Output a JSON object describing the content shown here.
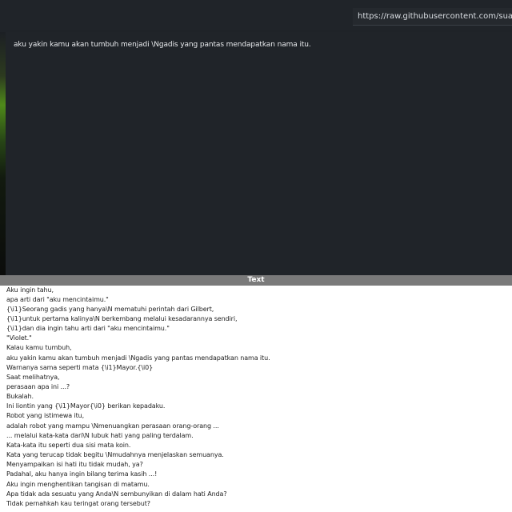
{
  "browser": {
    "url": "https://raw.githubusercontent.com/suakaani..."
  },
  "preview": {
    "caption": "aku yakin kamu akan tumbuh menjadi \\Ngadis yang pantas mendapatkan nama itu."
  },
  "text_panel": {
    "header": "Text",
    "lines": [
      "Aku ingin tahu,",
      "apa arti dari \"aku mencintaimu.\"",
      "{\\i1}Seorang gadis yang hanya\\N mematuhi perintah dari Gilbert,",
      "{\\i1}untuk pertama kalinya\\N berkembang melalui kesadarannya sendiri,",
      "{\\i1}dan dia ingin tahu arti dari \"aku mencintaimu.\"",
      "\"Violet.\"",
      "Kalau kamu tumbuh,",
      "aku yakin kamu akan tumbuh menjadi \\Ngadis yang pantas mendapatkan nama itu.",
      "Warnanya sama seperti mata {\\i1}Mayor.{\\i0}",
      "Saat melihatnya,",
      "perasaan apa ini ...?",
      "Bukalah.",
      "Ini liontin yang {\\i1}Mayor{\\i0} berikan kepadaku.",
      "Robot yang istimewa itu,",
      "adalah robot yang mampu \\Nmenuangkan perasaan orang-orang ...",
      "... melalui kata-kata dari\\N lubuk hati yang paling terdalam.",
      "Kata-kata itu seperti dua sisi mata koin.",
      "Kata yang terucap tidak begitu \\Nmudahnya menjelaskan semuanya.",
      "Menyampaikan isi hati itu tidak mudah, ya?",
      "Padahal, aku hanya ingin bilang terima kasih ...!",
      "Aku ingin menghentikan tangisan di matamu.",
      "Apa tidak ada sesuatu yang Anda\\N sembunyikan di dalam hati Anda?",
      "Tidak pernahkah kau teringat orang tersebut?"
    ]
  }
}
